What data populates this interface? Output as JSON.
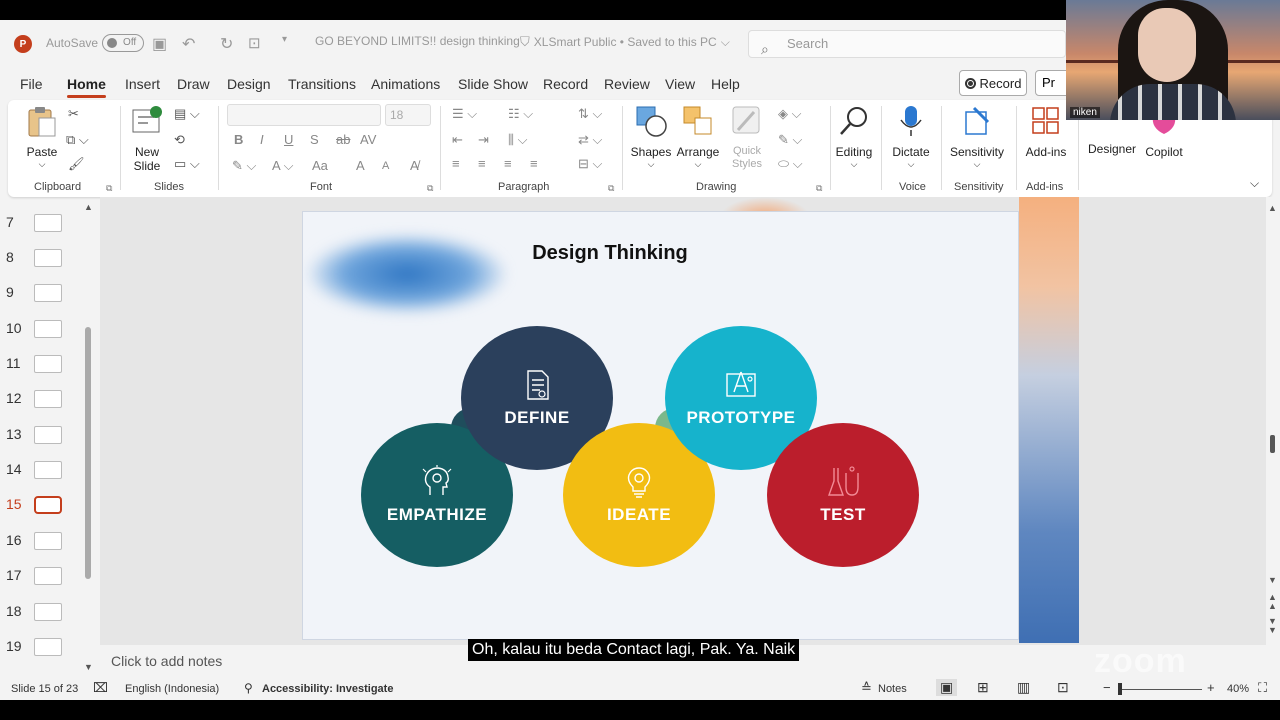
{
  "titlebar": {
    "autosave_label": "AutoSave",
    "autosave_state": "Off",
    "doc_title": "GO BEYOND LIMITS!! design thinking",
    "sensitivity_label": "XLSmart Public • Saved to this PC",
    "search_placeholder": "Search"
  },
  "menu": {
    "tabs": [
      "File",
      "Home",
      "Insert",
      "Draw",
      "Design",
      "Transitions",
      "Animations",
      "Slide Show",
      "Record",
      "Review",
      "View",
      "Help"
    ],
    "active_tab": "Home",
    "record_label": "Record",
    "present_label": "Pr"
  },
  "ribbon": {
    "clipboard": {
      "paste": "Paste",
      "label": "Clipboard"
    },
    "slides": {
      "new_slide": "New Slide",
      "label": "Slides"
    },
    "font": {
      "size": "18",
      "label": "Font",
      "bold": "B",
      "italic": "I",
      "underline": "U",
      "shadow": "S",
      "strike": "ab",
      "spacing": "AV",
      "grow": "A",
      "shrink": "A",
      "case": "Aa"
    },
    "paragraph": {
      "label": "Paragraph"
    },
    "drawing": {
      "shapes": "Shapes",
      "arrange": "Arrange",
      "quick_styles": "Quick Styles",
      "label": "Drawing"
    },
    "editing": {
      "label": "Editing"
    },
    "voice": {
      "dictate": "Dictate",
      "label": "Voice"
    },
    "sensitivity": {
      "button": "Sensitivity",
      "label": "Sensitivity"
    },
    "addins": {
      "button": "Add-ins",
      "label": "Add-ins"
    },
    "designer": "Designer",
    "copilot": "Copilot"
  },
  "webcam": {
    "name": "niken"
  },
  "thumbnails": [
    {
      "num": "7"
    },
    {
      "num": "8"
    },
    {
      "num": "9"
    },
    {
      "num": "10"
    },
    {
      "num": "11"
    },
    {
      "num": "12"
    },
    {
      "num": "13"
    },
    {
      "num": "14"
    },
    {
      "num": "15",
      "active": true
    },
    {
      "num": "16"
    },
    {
      "num": "17"
    },
    {
      "num": "18"
    },
    {
      "num": "19"
    }
  ],
  "slide": {
    "title": "Design Thinking",
    "stages": [
      {
        "label": "EMPATHIZE",
        "color": "#155e63",
        "icon": "head-gear-icon"
      },
      {
        "label": "DEFINE",
        "color": "#2b405c",
        "icon": "document-icon"
      },
      {
        "label": "IDEATE",
        "color": "#f2bd12",
        "icon": "lightbulb-icon"
      },
      {
        "label": "PROTOTYPE",
        "color": "#16b3cc",
        "icon": "blueprint-icon"
      },
      {
        "label": "TEST",
        "color": "#bb1e2c",
        "icon": "flask-icon"
      }
    ]
  },
  "caption": "Oh, kalau itu beda Contact lagi, Pak. Ya. Naik",
  "notes_placeholder": "Click to add notes",
  "statusbar": {
    "slide_info": "Slide 15 of 23",
    "language": "English (Indonesia)",
    "accessibility": "Accessibility: Investigate",
    "notes": "Notes",
    "zoom": "40%"
  },
  "watermark": "zoom"
}
